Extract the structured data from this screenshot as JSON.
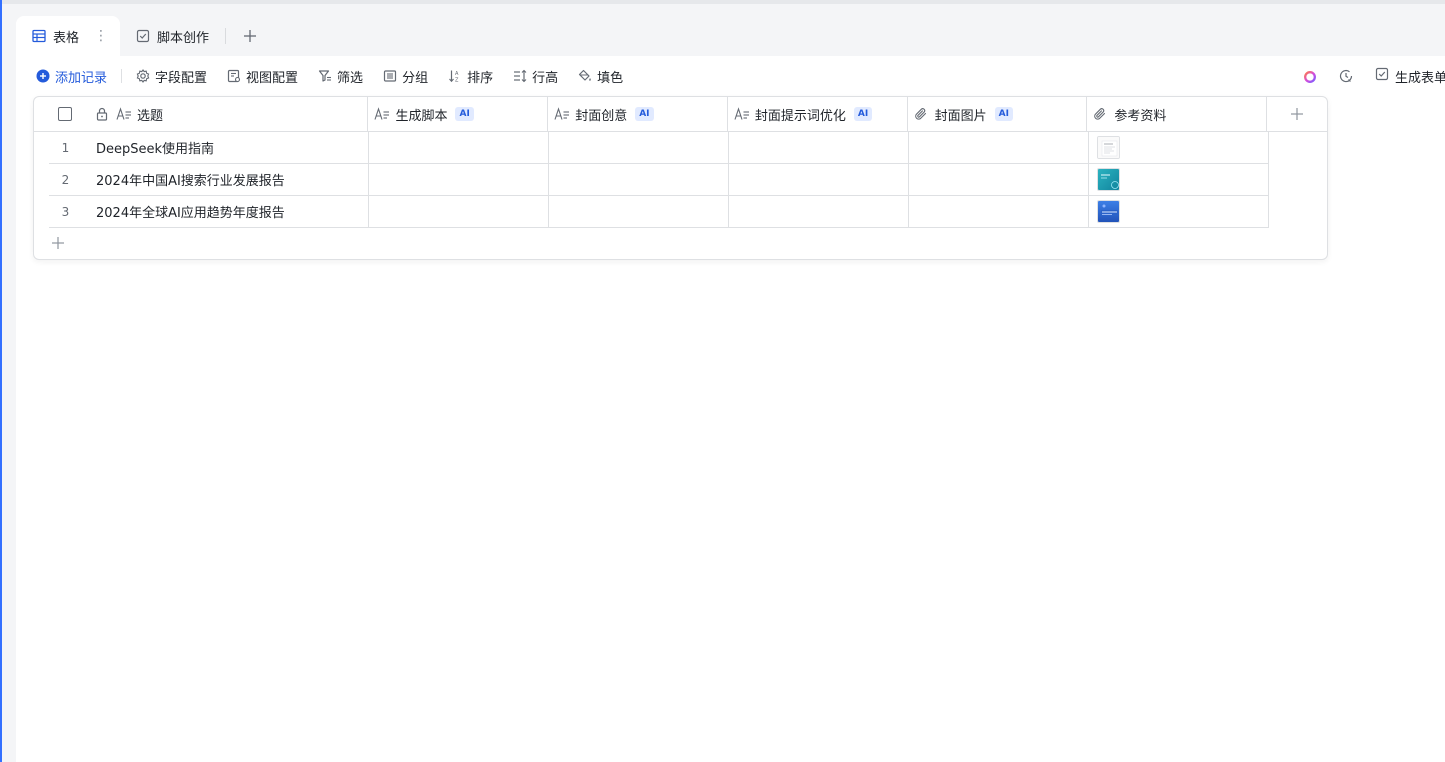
{
  "tabs": [
    {
      "label": "表格",
      "icon": "table-icon",
      "active": true
    },
    {
      "label": "脚本创作",
      "icon": "checkbox-form-icon",
      "active": false
    }
  ],
  "toolbar": {
    "add_record": "添加记录",
    "field_config": "字段配置",
    "view_config": "视图配置",
    "filter": "筛选",
    "group": "分组",
    "sort": "排序",
    "row_height": "行高",
    "fill_color": "填色",
    "generate_form": "生成表单"
  },
  "table": {
    "columns": [
      {
        "label": "选题",
        "icon": "text-icon",
        "locked": true,
        "ai": false
      },
      {
        "label": "生成脚本",
        "icon": "text-icon",
        "ai": true
      },
      {
        "label": "封面创意",
        "icon": "text-icon",
        "ai": true
      },
      {
        "label": "封面提示词优化",
        "icon": "text-icon",
        "ai": true
      },
      {
        "label": "封面图片",
        "icon": "attachment-icon",
        "ai": true
      },
      {
        "label": "参考资料",
        "icon": "attachment-icon",
        "ai": false
      }
    ],
    "ai_tag": "AI",
    "rows": [
      {
        "num": "1",
        "title": "DeepSeek使用指南"
      },
      {
        "num": "2",
        "title": "2024年中国AI搜索行业发展报告"
      },
      {
        "num": "3",
        "title": "2024年全球AI应用趋势年度报告"
      }
    ]
  },
  "colors": {
    "accent": "#245bdb",
    "border": "#dee0e3",
    "background": "#f4f5f7"
  }
}
